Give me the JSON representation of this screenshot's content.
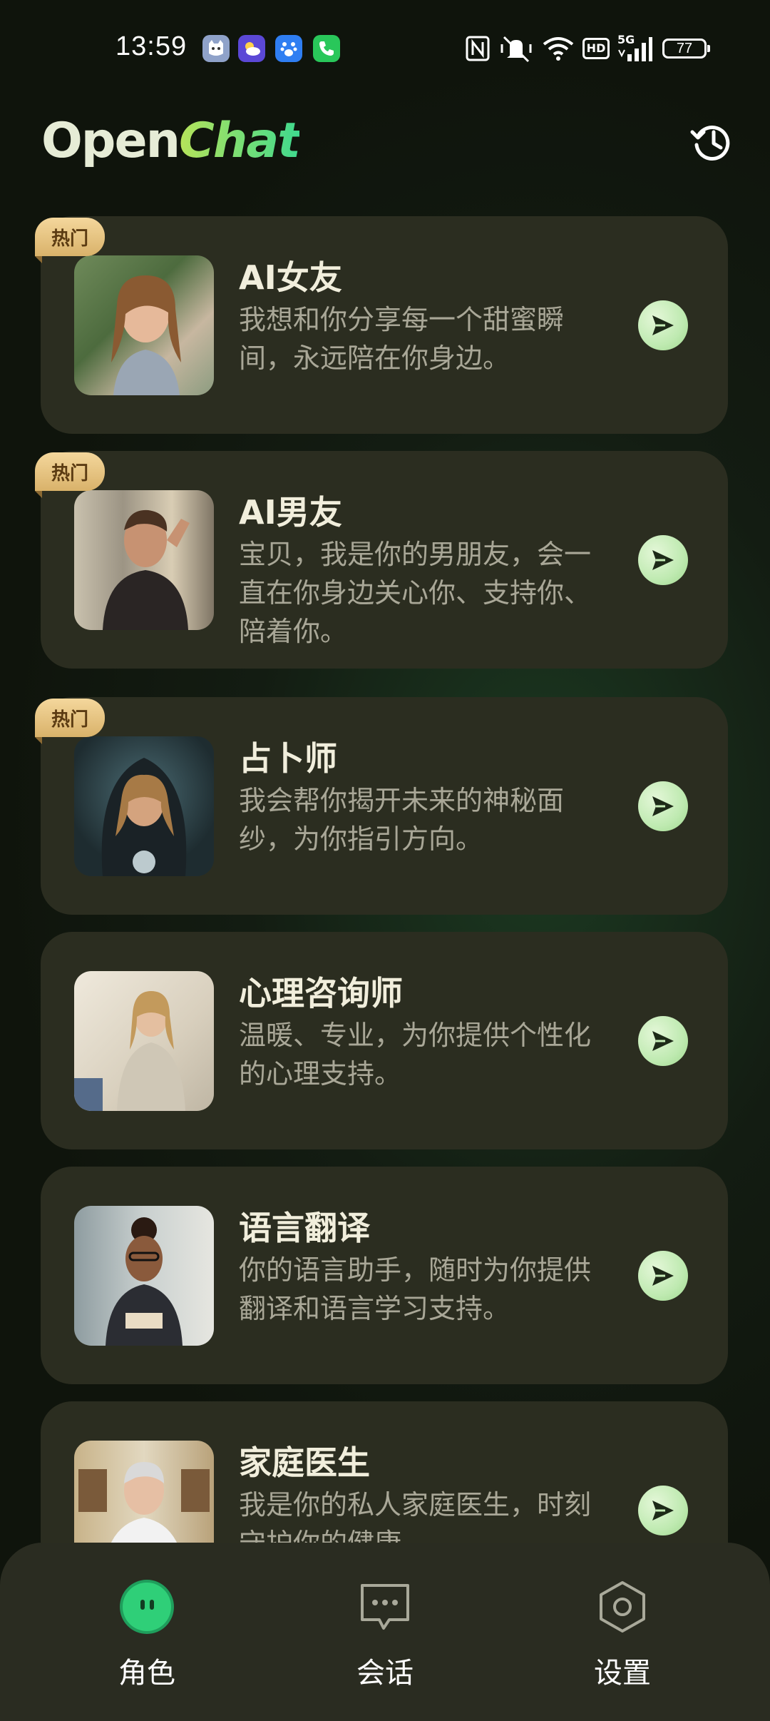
{
  "status_bar": {
    "time": "13:59",
    "battery": "77",
    "network": "5G",
    "hd_label": "HD",
    "nfc_label": "N",
    "notification_icons": [
      "cat-app-icon",
      "weather-icon",
      "baidu-icon",
      "phone-icon"
    ]
  },
  "header": {
    "logo_open": "Open",
    "logo_chat": "Chat",
    "history_icon": "history-icon"
  },
  "roles": [
    {
      "title": "AI女友",
      "description": "我想和你分享每一个甜蜜瞬间，永远陪在你身边。",
      "hot": true,
      "hot_label": "热门"
    },
    {
      "title": "AI男友",
      "description": "宝贝，我是你的男朋友，会一直在你身边关心你、支持你、陪着你。",
      "hot": true,
      "hot_label": "热门"
    },
    {
      "title": "占卜师",
      "description": "我会帮你揭开未来的神秘面纱，为你指引方向。",
      "hot": true,
      "hot_label": "热门"
    },
    {
      "title": "心理咨询师",
      "description": "温暖、专业，为你提供个性化的心理支持。",
      "hot": false
    },
    {
      "title": "语言翻译",
      "description": "你的语言助手，随时为你提供翻译和语言学习支持。",
      "hot": false
    },
    {
      "title": "家庭医生",
      "description": "我是你的私人家庭医生，时刻守护你的健康。",
      "hot": false
    }
  ],
  "bottom_nav": [
    {
      "label": "角色",
      "icon": "character-icon",
      "active": true
    },
    {
      "label": "会话",
      "icon": "chat-bubble-icon",
      "active": false
    },
    {
      "label": "设置",
      "icon": "settings-hexagon-icon",
      "active": false
    }
  ],
  "colors": {
    "accent_green": "#2fcf78",
    "hot_badge": "#e8c37f",
    "card_bg": "#2b2d20",
    "send_button": "#c6eeb8"
  }
}
